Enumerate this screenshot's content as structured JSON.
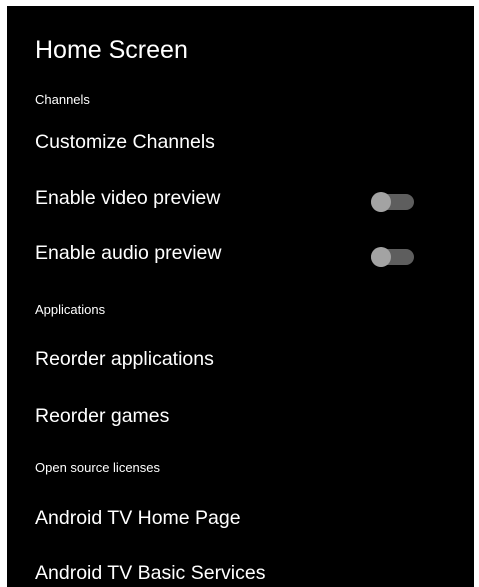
{
  "header": {
    "title": "Home Screen"
  },
  "sections": {
    "channels": "Channels",
    "applications": "Applications",
    "licenses": "Open source licenses"
  },
  "items": {
    "customize_channels": "Customize Channels",
    "enable_video_preview": "Enable video preview",
    "enable_audio_preview": "Enable audio preview",
    "reorder_applications": "Reorder applications",
    "reorder_games": "Reorder games",
    "android_tv_home_page": "Android TV Home Page",
    "android_tv_basic_services": "Android TV Basic Services"
  },
  "toggles": {
    "video_preview": "off",
    "audio_preview": "off"
  },
  "colors": {
    "panel_background": "#000000",
    "text": "#ffffff",
    "toggle_track": "#5e5e5e",
    "toggle_knob": "#a3a3a3"
  }
}
